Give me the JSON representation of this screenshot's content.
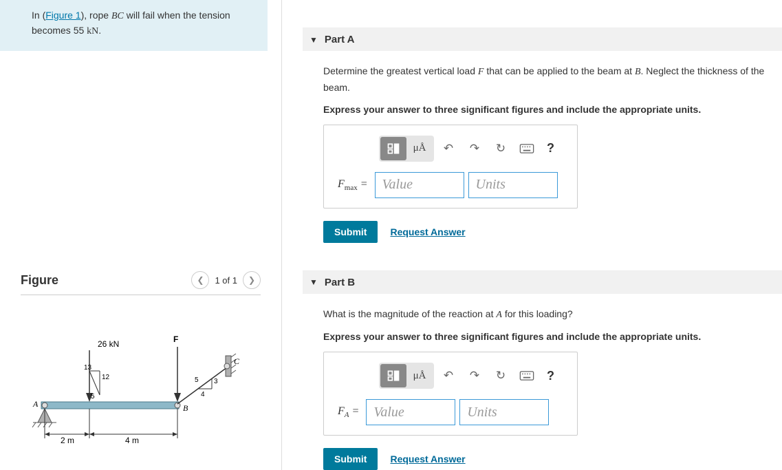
{
  "intro": {
    "prefix": "In (",
    "figure_link": "Figure 1",
    "mid": "), rope ",
    "rope": "BC",
    "suffix1": " will fail when the tension becomes ",
    "value": "55",
    "unit": "kN",
    "suffix2": "."
  },
  "figure": {
    "title": "Figure",
    "nav": "1 of 1",
    "labels": {
      "force": "26 kN",
      "F": "F",
      "A": "A",
      "B": "B",
      "C": "C",
      "d1": "2 m",
      "d2": "4 m",
      "t13": "13",
      "t12": "12",
      "t5": "5",
      "r5": "5",
      "r4": "4",
      "r3": "3"
    }
  },
  "parts": [
    {
      "title": "Part A",
      "q_pre": "Determine the greatest vertical load ",
      "q_var": "F",
      "q_mid": " that can be applied to the beam at ",
      "q_pt": "B",
      "q_post": ". Neglect the thickness of the beam.",
      "instr": "Express your answer to three significant figures and include the appropriate units.",
      "var_label_main": "F",
      "var_label_sub": "max",
      "value_ph": "Value",
      "units_ph": "Units",
      "mu": "μÅ",
      "submit": "Submit",
      "request": "Request Answer",
      "help": "?"
    },
    {
      "title": "Part B",
      "q_pre": "What is the magnitude of the reaction at ",
      "q_var": "A",
      "q_mid": " for this loading?",
      "q_pt": "",
      "q_post": "",
      "instr": "Express your answer to three significant figures and include the appropriate units.",
      "var_label_main": "F",
      "var_label_sub": "A",
      "value_ph": "Value",
      "units_ph": "Units",
      "mu": "μÅ",
      "submit": "Submit",
      "request": "Request Answer",
      "help": "?"
    }
  ]
}
